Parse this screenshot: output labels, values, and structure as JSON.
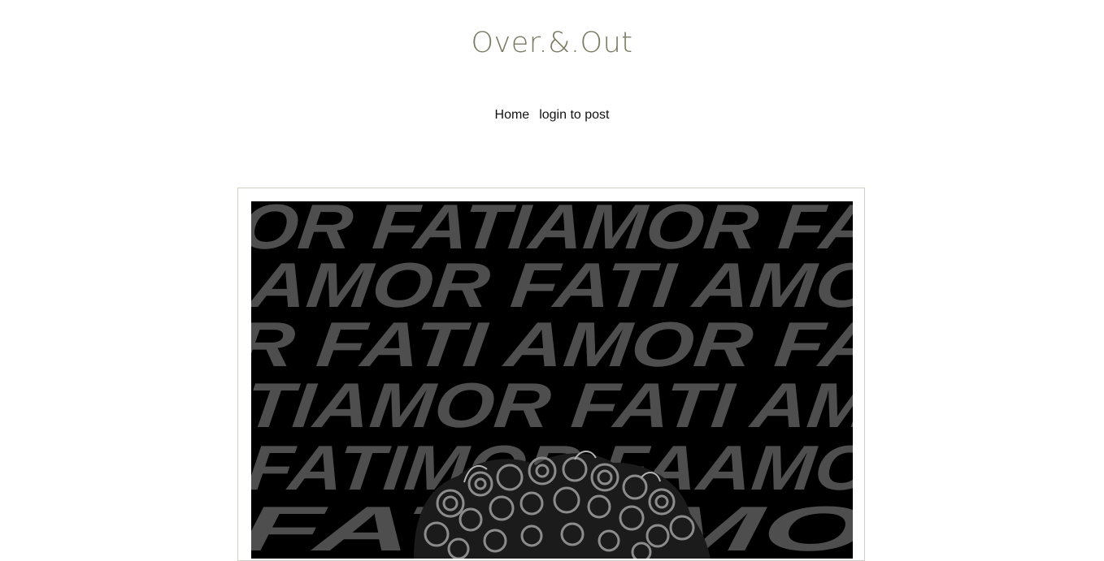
{
  "site": {
    "title": "Over.&.Out"
  },
  "nav": {
    "items": [
      {
        "label": "Home"
      },
      {
        "label": "login to post"
      }
    ]
  },
  "post": {
    "image": {
      "lines": [
        "OR FATIAMOR FA",
        "AMOR FATI AMO",
        "R FATI AMOR FA",
        "TIAMOR FATI AM",
        "FATIMOR FAAMO",
        "FATI         AMO"
      ],
      "colors": {
        "background": "#000000",
        "text": "#4e4e4e"
      }
    }
  }
}
